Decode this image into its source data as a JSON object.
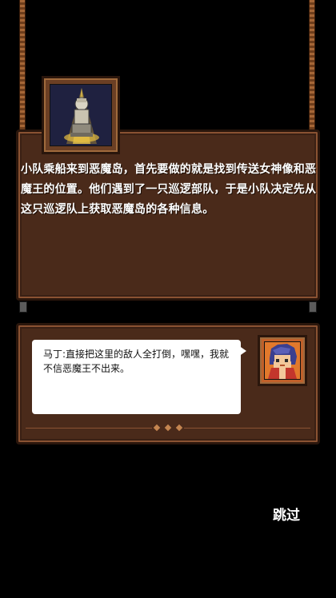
{
  "story": {
    "narration": "小队乘船来到恶魔岛，首先要做的就是找到传送女神像和恶魔王的位置。他们遇到了一只巡逻部队，于是小队决定先从这只巡逻队上获取恶魔岛的各种信息。",
    "portrait_icon": "goddess-statue-icon"
  },
  "dialogue": {
    "text": "马丁:直接把这里的敌人全打倒，嘿嘿，我就不信恶魔王不出来。",
    "portrait_icon": "blue-haired-hero-portrait"
  },
  "controls": {
    "skip_label": "跳过"
  },
  "colors": {
    "board": "#4a2a1a",
    "board_border": "#8a5232",
    "rope": "#a56636",
    "bubble": "#ffffff"
  }
}
